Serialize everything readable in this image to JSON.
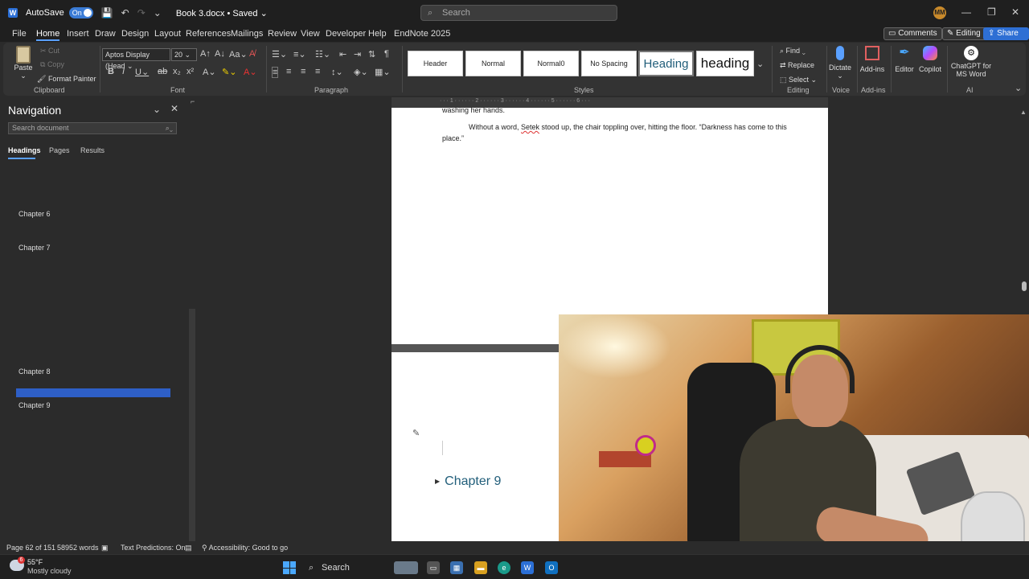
{
  "titlebar": {
    "autosave_label": "AutoSave",
    "autosave_state": "On",
    "doc_title": "Book 3.docx • Saved",
    "search_placeholder": "Search",
    "avatar": "MM"
  },
  "menu": {
    "items": [
      "File",
      "Home",
      "Insert",
      "Draw",
      "Design",
      "Layout",
      "References",
      "Mailings",
      "Review",
      "View",
      "Developer",
      "Help",
      "EndNote 2025"
    ],
    "active": "Home",
    "comments": "Comments",
    "editing": "Editing",
    "share": "Share"
  },
  "ribbon": {
    "clipboard": {
      "paste": "Paste",
      "cut": "Cut",
      "copy": "Copy",
      "format_painter": "Format Painter",
      "label": "Clipboard"
    },
    "font": {
      "name": "Aptos Display (Head",
      "size": "20",
      "label": "Font"
    },
    "paragraph": {
      "label": "Paragraph"
    },
    "styles": {
      "items": [
        "Header",
        "Normal",
        "Normal0",
        "No Spacing",
        "Heading",
        "heading"
      ],
      "label": "Styles"
    },
    "editing": {
      "find": "Find",
      "replace": "Replace",
      "select": "Select",
      "label": "Editing"
    },
    "voice": {
      "dictate": "Dictate",
      "label": "Voice"
    },
    "addins": {
      "addins": "Add-ins",
      "label": "Add-ins"
    },
    "editor": "Editor",
    "copilot": "Copilot",
    "ai": {
      "chatgpt": "ChatGPT for MS Word",
      "label": "AI"
    }
  },
  "nav": {
    "title": "Navigation",
    "search_placeholder": "Search document",
    "tabs": [
      "Headings",
      "Pages",
      "Results"
    ],
    "headings": [
      "Chapter 6",
      "Chapter 7",
      "Chapter 8",
      "Chapter 9"
    ]
  },
  "document": {
    "line_top": "washing her hands.",
    "para1_a": "Without a word, ",
    "para1_name": "Setek",
    "para1_b": " stood up, the chair toppling over, hitting the floor. “Darkness has come to",
    "para1_c": "this place.”",
    "chapter_heading": "Chapter 9"
  },
  "statusbar": {
    "page": "Page 62 of 151",
    "words": "58952 words",
    "text_predictions": "Text Predictions: On",
    "accessibility": "Accessibility: Good to go"
  },
  "taskbar": {
    "temperature": "55°F",
    "weather": "Mostly cloudy",
    "search": "Search",
    "badge": "6"
  },
  "colors": {
    "accent": "#2e6fd4",
    "heading": "#215e7a",
    "nav_selected": "#2e5fc7"
  }
}
